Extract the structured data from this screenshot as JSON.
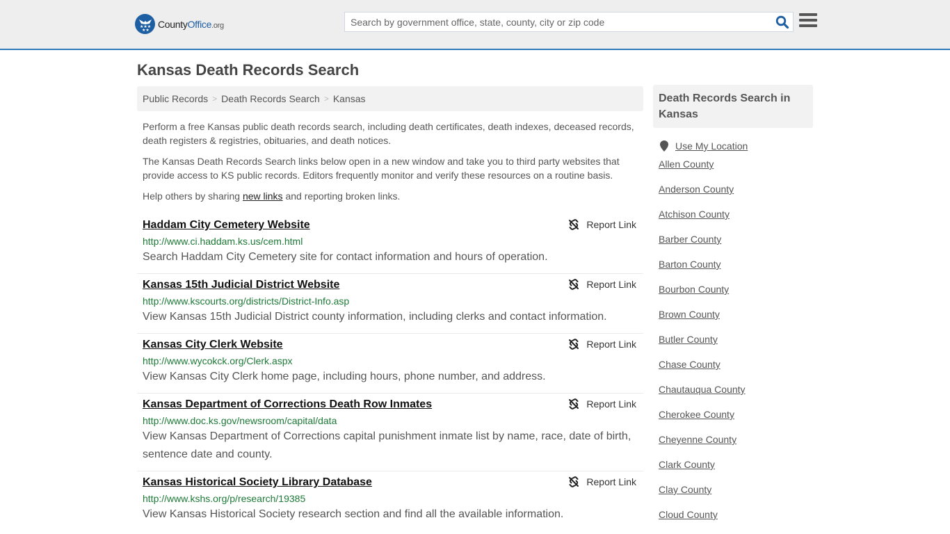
{
  "header": {
    "logo": {
      "name": "County",
      "office": "Office",
      "tld": ".org",
      "icon": "eagle-stars-icon"
    },
    "search": {
      "placeholder": "Search by government office, state, county, city or zip code",
      "value": ""
    },
    "search_icon": "search-icon",
    "menu_icon": "hamburger-menu-icon"
  },
  "page": {
    "title": "Kansas Death Records Search",
    "breadcrumb": [
      {
        "label": "Public Records"
      },
      {
        "label": "Death Records Search"
      },
      {
        "label": "Kansas"
      }
    ],
    "breadcrumb_separator": ">",
    "intro": {
      "p1": "Perform a free Kansas public death records search, including death certificates, death indexes, deceased records, death registers & registries, obituaries, and death notices.",
      "p2": "The Kansas Death Records Search links below open in a new window and take you to third party websites that provide access to KS public records. Editors frequently monitor and verify these resources on a routine basis.",
      "p3_before": "Help others by sharing ",
      "p3_link": "new links",
      "p3_after": " and reporting broken links."
    }
  },
  "results": [
    {
      "title": "Haddam City Cemetery Website",
      "url": "http://www.ci.haddam.ks.us/cem.html",
      "description": "Search Haddam City Cemetery site for contact information and hours of operation.",
      "report_label": "Report Link"
    },
    {
      "title": "Kansas 15th Judicial District Website",
      "url": "http://www.kscourts.org/districts/District-Info.asp",
      "description": "View Kansas 15th Judicial District county information, including clerks and contact information.",
      "report_label": "Report Link"
    },
    {
      "title": "Kansas City Clerk Website",
      "url": "http://www.wycokck.org/Clerk.aspx",
      "description": "View Kansas City Clerk home page, including hours, phone number, and address.",
      "report_label": "Report Link"
    },
    {
      "title": "Kansas Department of Corrections Death Row Inmates",
      "url": "http://www.doc.ks.gov/newsroom/capital/data",
      "description": "View Kansas Department of Corrections capital punishment inmate list by name, race, date of birth, sentence date and county.",
      "report_label": "Report Link"
    },
    {
      "title": "Kansas Historical Society Library Database",
      "url": "http://www.kshs.org/p/research/19385",
      "description": "View Kansas Historical Society research section and find all the available information.",
      "report_label": "Report Link"
    }
  ],
  "sidebar": {
    "title": "Death Records Search in Kansas",
    "use_location": "Use My Location",
    "counties": [
      "Allen County",
      "Anderson County",
      "Atchison County",
      "Barber County",
      "Barton County",
      "Bourbon County",
      "Brown County",
      "Butler County",
      "Chase County",
      "Chautauqua County",
      "Cherokee County",
      "Cheyenne County",
      "Clark County",
      "Clay County",
      "Cloud County"
    ]
  },
  "colors": {
    "brand_blue": "#1e5fa3",
    "header_border": "#2e78b7",
    "url_green": "#1d7a37",
    "header_bg": "#eeeeee"
  }
}
